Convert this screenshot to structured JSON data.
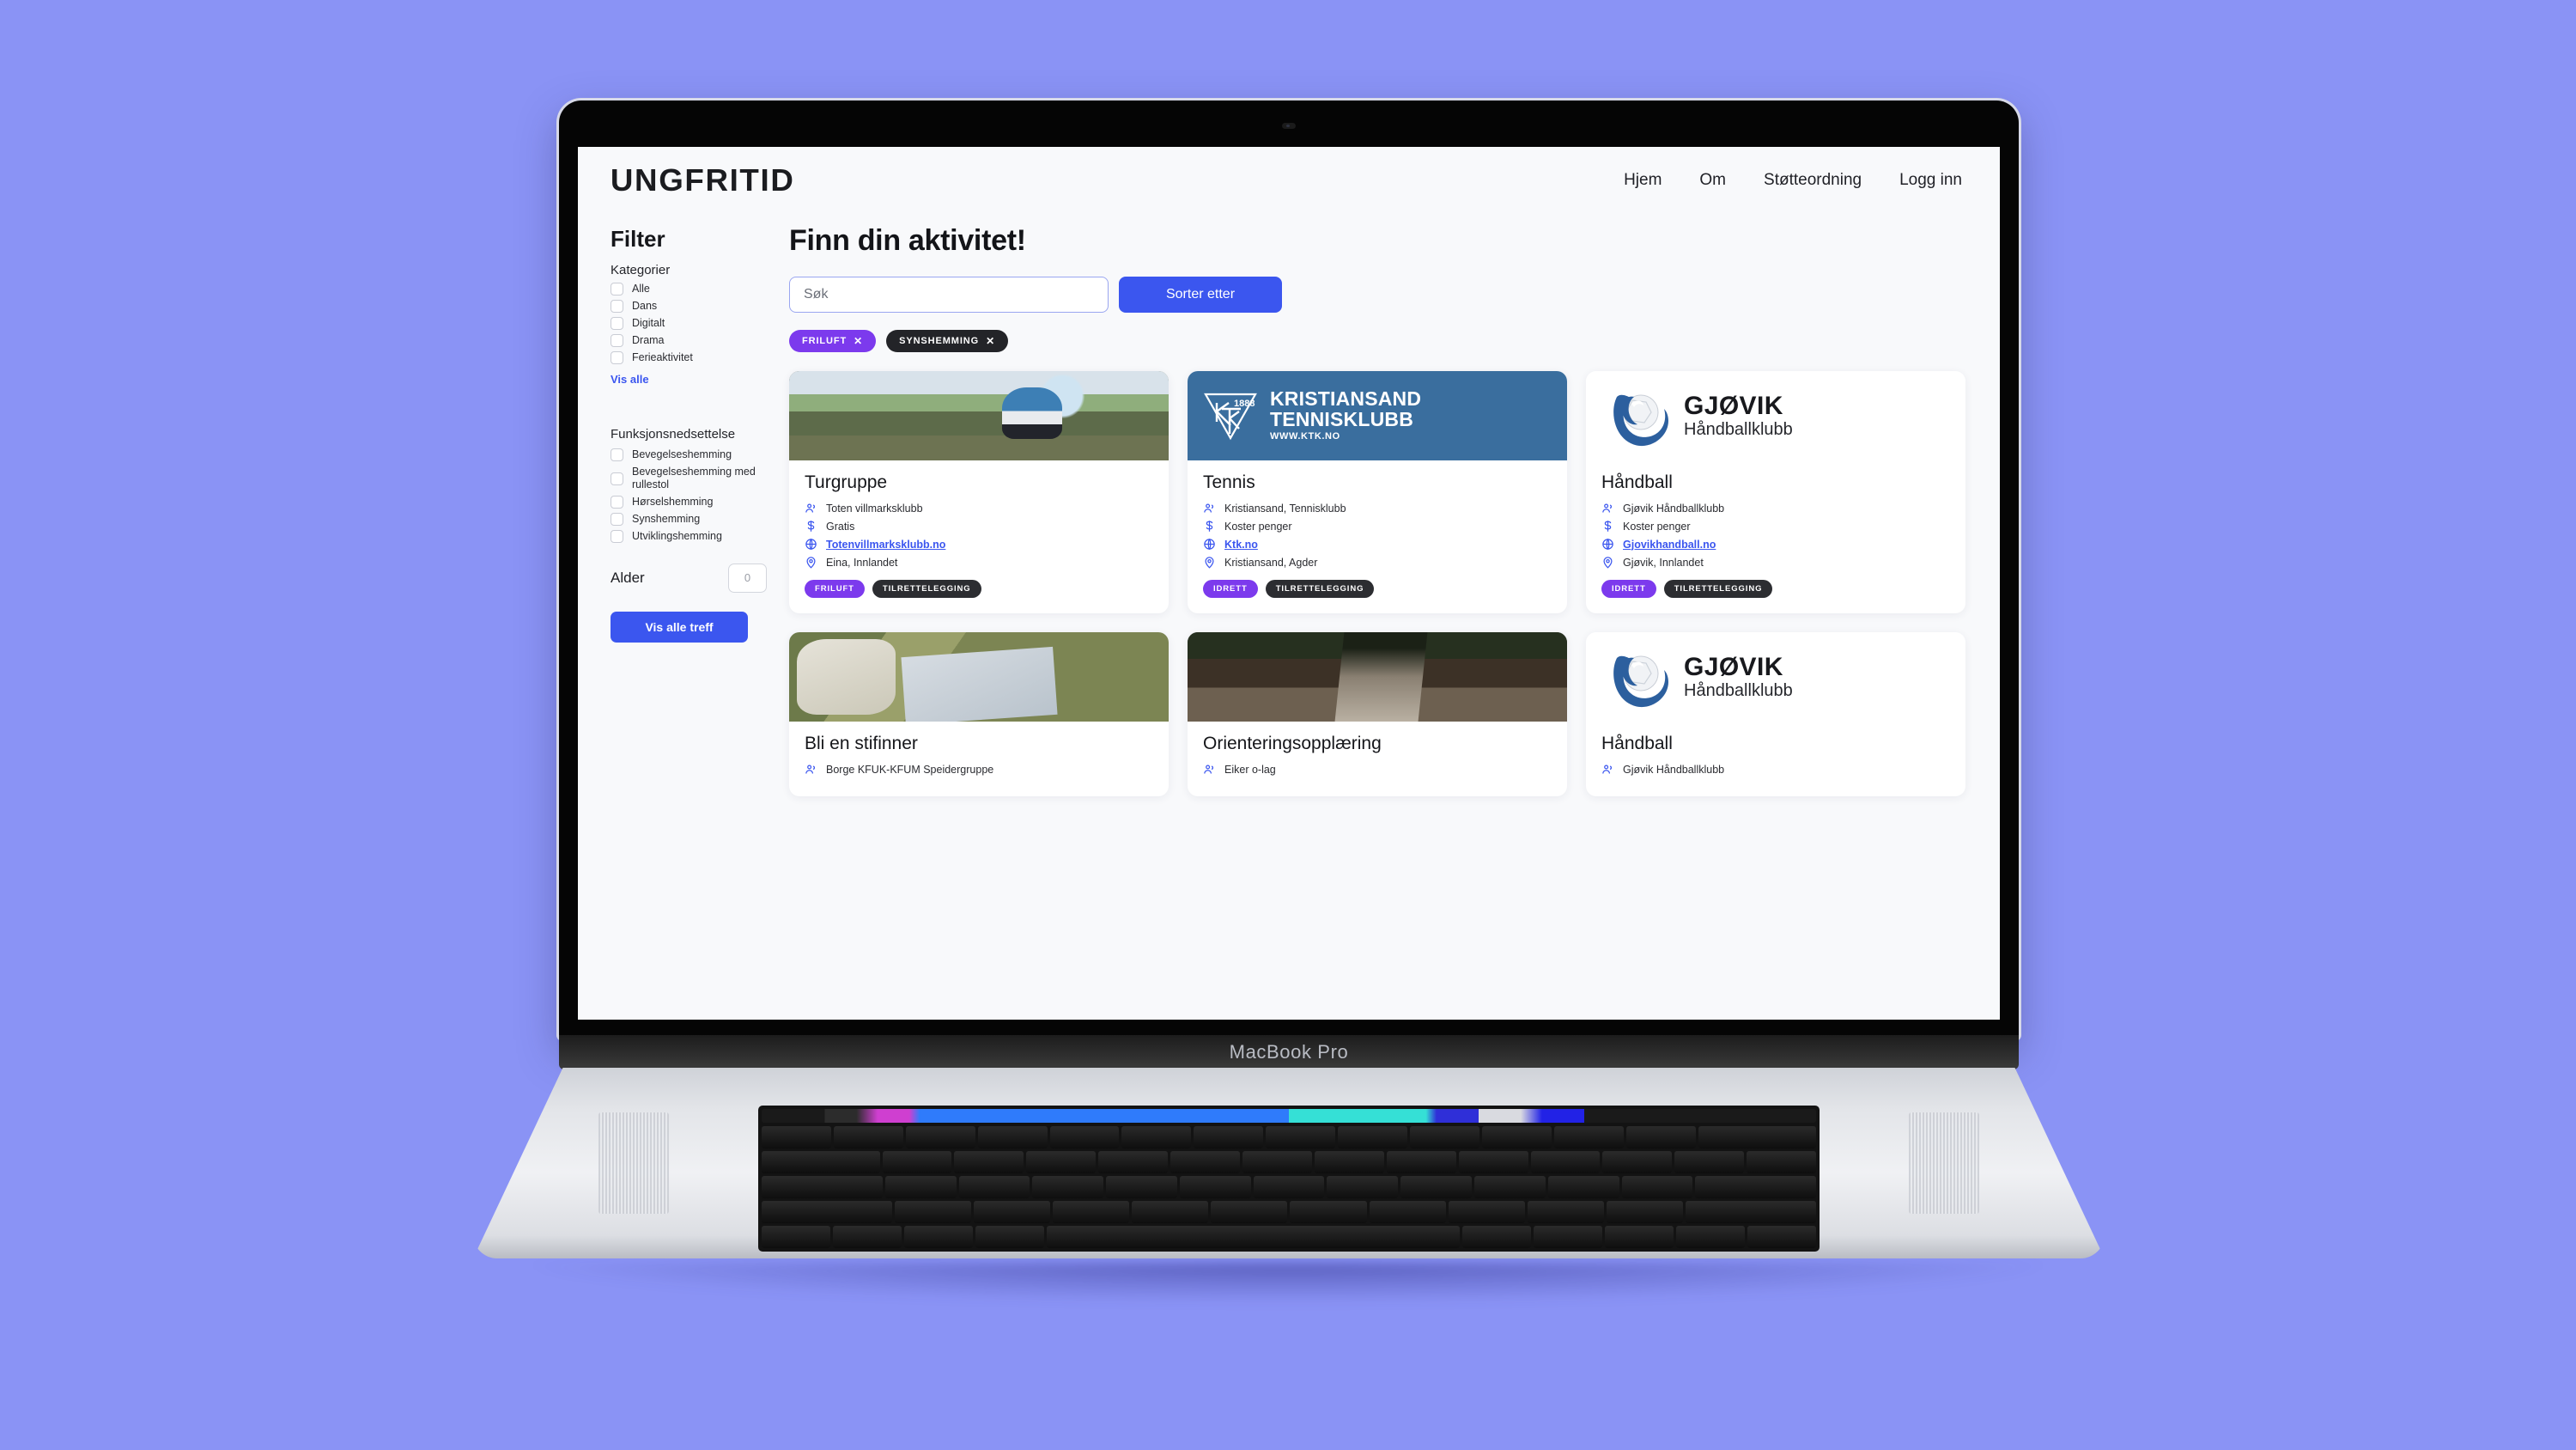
{
  "mockup": {
    "device_label": "MacBook Pro",
    "background_color": "#8a93f5"
  },
  "site": {
    "brand": "UNGFRITID",
    "nav": [
      {
        "label": "Hjem"
      },
      {
        "label": "Om"
      },
      {
        "label": "Støtteordning"
      },
      {
        "label": "Logg inn"
      }
    ]
  },
  "sidebar": {
    "title": "Filter",
    "categories": {
      "title": "Kategorier",
      "items": [
        {
          "label": "Alle",
          "checked": false
        },
        {
          "label": "Dans",
          "checked": false
        },
        {
          "label": "Digitalt",
          "checked": false
        },
        {
          "label": "Drama",
          "checked": false
        },
        {
          "label": "Ferieaktivitet",
          "checked": false
        }
      ],
      "show_all": "Vis alle"
    },
    "disability": {
      "title": "Funksjonsnedsettelse",
      "items": [
        {
          "label": "Bevegelseshemming",
          "checked": false
        },
        {
          "label": "Bevegelseshemming med rullestol",
          "checked": false
        },
        {
          "label": "Hørselshemming",
          "checked": false
        },
        {
          "label": "Synshemming",
          "checked": false
        },
        {
          "label": "Utviklingshemming",
          "checked": false
        }
      ]
    },
    "age": {
      "label": "Alder",
      "value": "",
      "placeholder": "0"
    },
    "submit_label": "Vis alle treff"
  },
  "main": {
    "title": "Finn din aktivitet!",
    "search": {
      "value": "",
      "placeholder": "Søk"
    },
    "sort_label": "Sorter etter",
    "active_filters": [
      {
        "label": "FRILUFT",
        "remove": "✕",
        "style": "purple"
      },
      {
        "label": "SYNSHEMMING",
        "remove": "✕",
        "style": "dark"
      }
    ],
    "cards": [
      {
        "title": "Turgruppe",
        "organizer": "Toten villmarksklubb",
        "price": "Gratis",
        "website": "Totenvillmarksklubb.no",
        "location": "Eina, Innlandet",
        "tags": [
          {
            "label": "FRILUFT",
            "style": "purple"
          },
          {
            "label": "TILRETTELEGGING",
            "style": "dark"
          }
        ],
        "media": {
          "kind": "photo",
          "theme": "mountain"
        }
      },
      {
        "title": "Tennis",
        "organizer": "Kristiansand, Tennisklubb",
        "price": "Koster penger",
        "website": "Ktk.no",
        "location": "Kristiansand, Agder",
        "tags": [
          {
            "label": "IDRETT",
            "style": "purple"
          },
          {
            "label": "TILRETTELEGGING",
            "style": "dark"
          }
        ],
        "media": {
          "kind": "logo",
          "theme": "ktk",
          "logo_line1": "KRISTIANSAND",
          "logo_line2": "TENNISKLUBB",
          "logo_line3": "WWW.KTK.NO",
          "logo_year": "1888",
          "logo_monogram": "KTK",
          "logo_bg": "#3a6e9e"
        }
      },
      {
        "title": "Håndball",
        "organizer": "Gjøvik Håndballklubb",
        "price": "Koster penger",
        "website": "Gjovikhandball.no",
        "location": "Gjøvik, Innlandet",
        "tags": [
          {
            "label": "IDRETT",
            "style": "purple"
          },
          {
            "label": "TILRETTELEGGING",
            "style": "dark"
          }
        ],
        "media": {
          "kind": "logo",
          "theme": "gjovik",
          "logo_line1": "GJØVIK",
          "logo_line2": "Håndballklubb",
          "logo_bg": "#ffffff"
        }
      },
      {
        "title": "Bli en stifinner",
        "organizer": "Borge KFUK-KFUM Speidergruppe",
        "media": {
          "kind": "photo",
          "theme": "scouts"
        }
      },
      {
        "title": "Orienteringsopplæring",
        "organizer": "Eiker o-lag",
        "media": {
          "kind": "photo",
          "theme": "trail"
        }
      },
      {
        "title": "Håndball",
        "organizer": "Gjøvik Håndballklubb",
        "media": {
          "kind": "logo",
          "theme": "gjovik",
          "logo_line1": "GJØVIK",
          "logo_line2": "Håndballklubb",
          "logo_bg": "#ffffff"
        }
      }
    ]
  },
  "colors": {
    "accent_blue": "#3b56ef",
    "accent_purple": "#7c3aed",
    "dark_chip": "#232428",
    "page_bg": "#f8f9fb"
  },
  "icons": {
    "organizer": "people-icon",
    "price": "dollar-icon",
    "website": "globe-icon",
    "location": "map-pin-icon"
  }
}
